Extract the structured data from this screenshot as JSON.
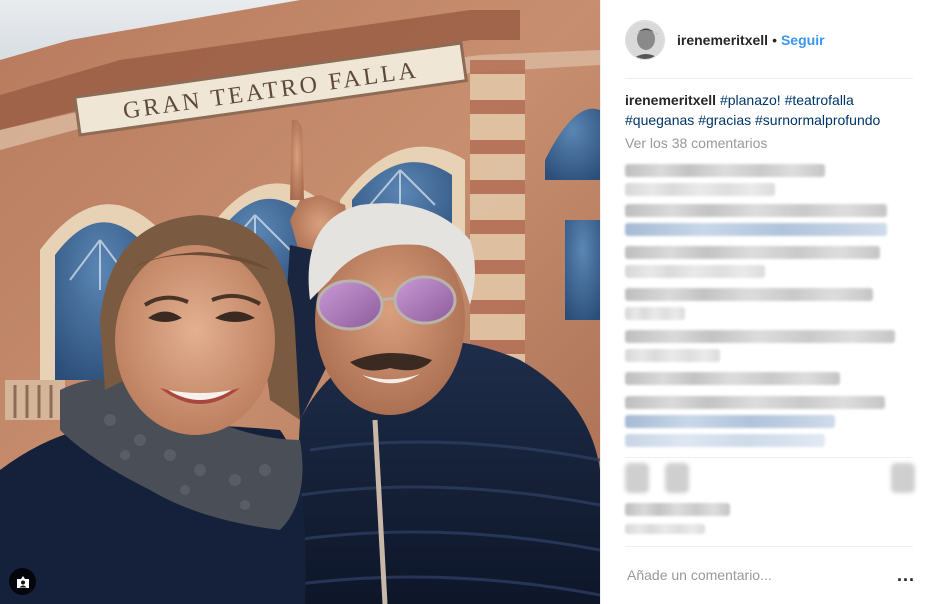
{
  "post": {
    "username": "irenemeritxell",
    "follow_separator": "•",
    "follow_label": "Seguir",
    "photo_sign_text": "GRAN TEATRO FALLA"
  },
  "caption": {
    "username": "irenemeritxell",
    "hashtags": [
      "#planazo!",
      "#teatrofalla",
      "#queganas",
      "#gracias",
      "#surnormalprofundo"
    ]
  },
  "comments": {
    "view_all_label": "Ver los 38 comentarios"
  },
  "comment_box": {
    "placeholder": "Añade un comentario...",
    "more_label": "..."
  },
  "icons": {
    "user_tag": "user-tag-icon",
    "more": "more-options-icon"
  },
  "colors": {
    "accent": "#3897f0",
    "hashtag": "#003569",
    "muted": "#999999",
    "text": "#262626"
  }
}
